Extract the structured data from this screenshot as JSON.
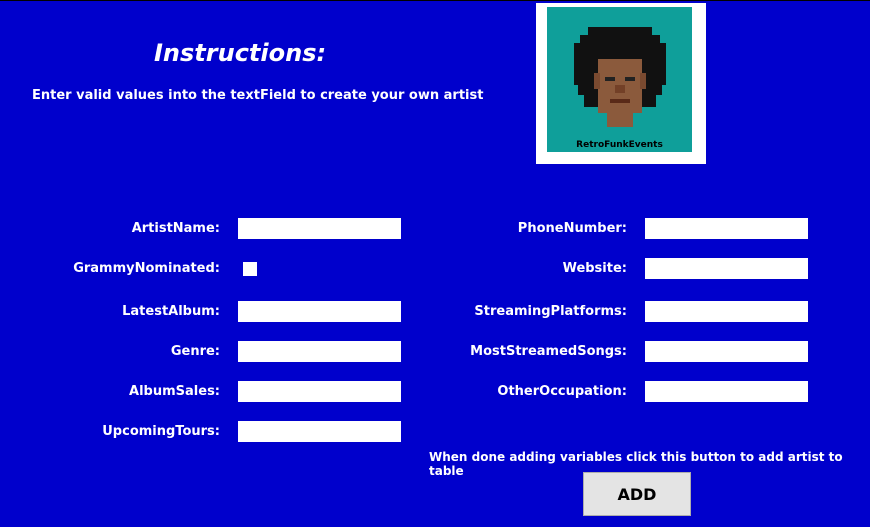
{
  "instructions": {
    "title": "Instructions:",
    "text": "Enter valid values into the textField to create your own artist"
  },
  "logo": {
    "text": "RetroFunkEvents",
    "background": "#0f9f9a"
  },
  "form": {
    "left": [
      {
        "label": "ArtistName:",
        "value": ""
      },
      {
        "label": "GrammyNominated:",
        "checked": false
      },
      {
        "label": "LatestAlbum:",
        "value": ""
      },
      {
        "label": "Genre:",
        "value": ""
      },
      {
        "label": "AlbumSales:",
        "value": ""
      },
      {
        "label": "UpcomingTours:",
        "value": ""
      }
    ],
    "right": [
      {
        "label": "PhoneNumber:",
        "value": ""
      },
      {
        "label": "Website:",
        "value": ""
      },
      {
        "label": "StreamingPlatforms:",
        "value": ""
      },
      {
        "label": "MostStreamedSongs:",
        "value": ""
      },
      {
        "label": "OtherOccupation:",
        "value": ""
      }
    ]
  },
  "footer": {
    "note": "When done adding variables click this button to add artist to table",
    "add_label": "ADD"
  },
  "colors": {
    "background": "#0000cc",
    "text": "#ffffff",
    "button": "#e4e4e4"
  }
}
